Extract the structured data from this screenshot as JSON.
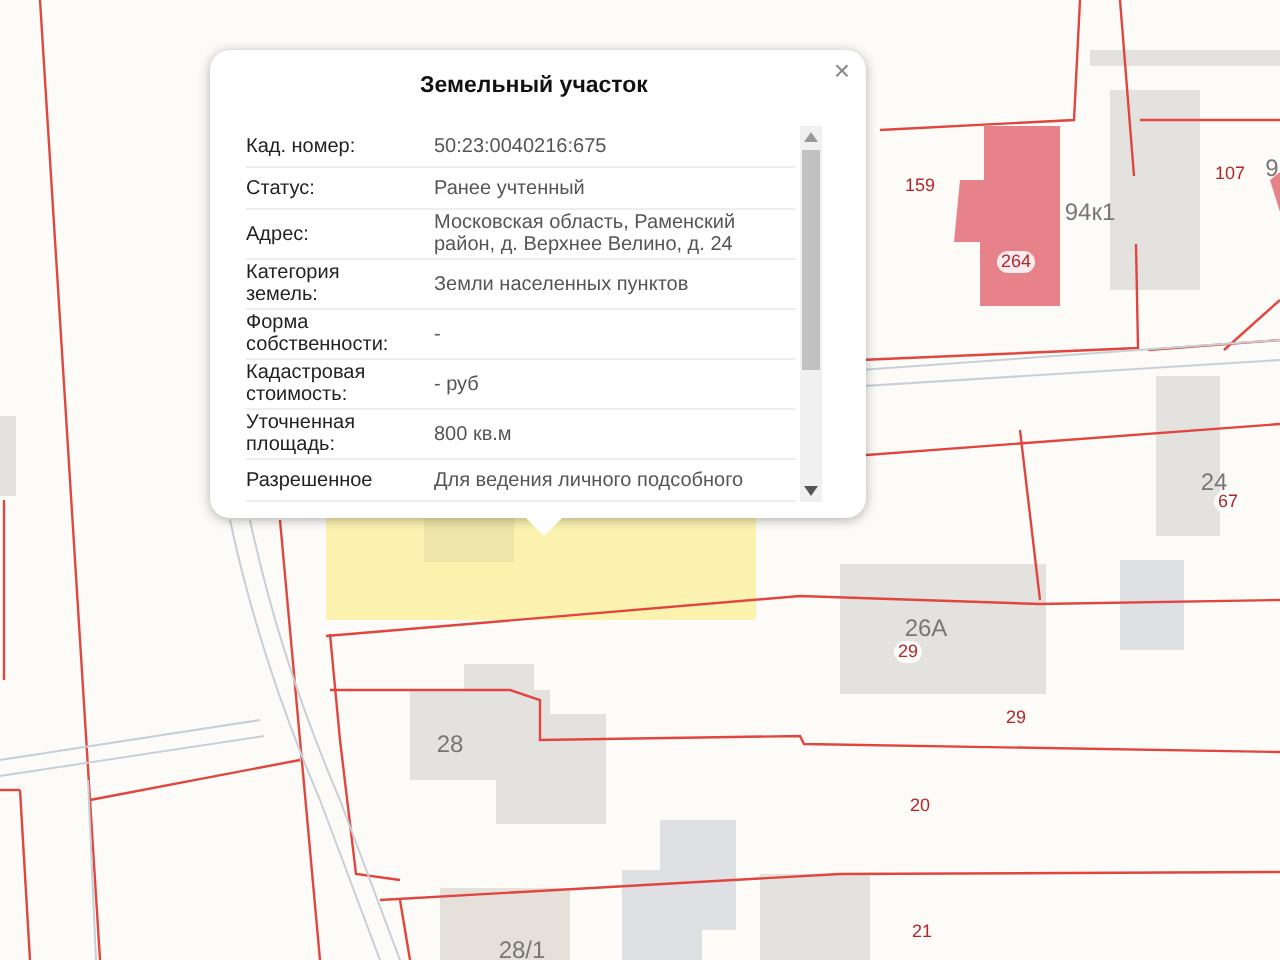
{
  "map": {
    "labels": [
      {
        "text": "159",
        "kind": "parcel"
      },
      {
        "text": "94к1",
        "kind": "house"
      },
      {
        "text": "264",
        "kind": "badge"
      },
      {
        "text": "107",
        "kind": "parcel"
      },
      {
        "text": "9",
        "kind": "house"
      },
      {
        "text": "24",
        "kind": "house"
      },
      {
        "text": "67",
        "kind": "badge"
      },
      {
        "text": "26А",
        "kind": "house"
      },
      {
        "text": "29",
        "kind": "badge"
      },
      {
        "text": "29",
        "kind": "parcel"
      },
      {
        "text": "28",
        "kind": "house"
      },
      {
        "text": "20",
        "kind": "parcel"
      },
      {
        "text": "21",
        "kind": "parcel"
      },
      {
        "text": "28/1",
        "kind": "house"
      }
    ]
  },
  "popup": {
    "title": "Земельный участок",
    "close": "×",
    "rows": [
      {
        "label": "Кад. номер:",
        "value": "50:23:0040216:675"
      },
      {
        "label": "Статус:",
        "value": "Ранее учтенный"
      },
      {
        "label": "Адрес:",
        "value": "Московская область, Раменский район, д. Верхнее Велино, д. 24"
      },
      {
        "label": "Категория земель:",
        "value": "Земли населенных пунктов"
      },
      {
        "label": "Форма собственности:",
        "value": "-"
      },
      {
        "label": "Кадастровая стоимость:",
        "value": "- руб"
      },
      {
        "label": "Уточненная площадь:",
        "value": "800 кв.м"
      },
      {
        "label": "Разрешенное",
        "value": "Для ведения личного подсобного"
      }
    ]
  }
}
